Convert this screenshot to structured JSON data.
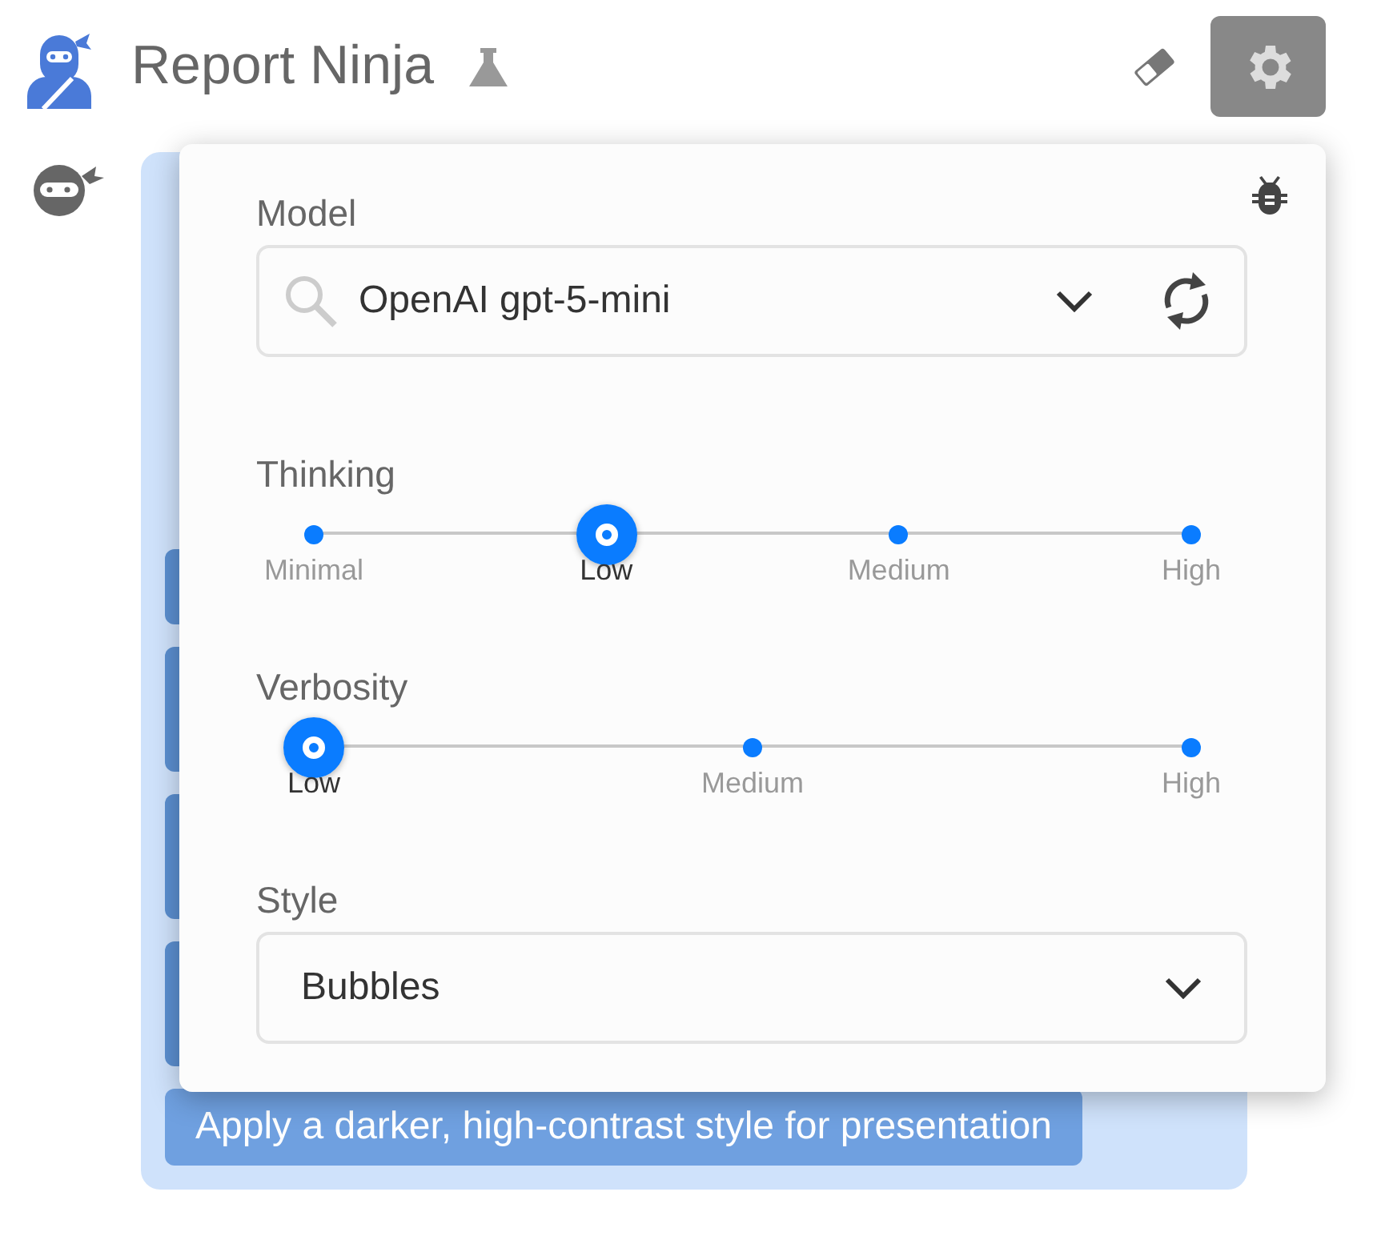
{
  "header": {
    "title": "Report Ninja"
  },
  "chat": {
    "message": {
      "suggestions": [
        {
          "kind": "hidden"
        },
        {
          "kind": "hidden"
        },
        {
          "kind": "hidden"
        },
        {
          "kind": "hidden"
        },
        {
          "kind": "text",
          "label": "Apply a darker, high-contrast style for presentation"
        }
      ]
    }
  },
  "settings_panel": {
    "model": {
      "label": "Model",
      "value": "OpenAI gpt-5-mini"
    },
    "sliders": [
      {
        "label": "Thinking",
        "options": [
          {
            "label": "Minimal",
            "selected": false
          },
          {
            "label": "Low",
            "selected": true
          },
          {
            "label": "Medium",
            "selected": false
          },
          {
            "label": "High",
            "selected": false
          }
        ]
      },
      {
        "label": "Verbosity",
        "options": [
          {
            "label": "Low",
            "selected": true
          },
          {
            "label": "Medium",
            "selected": false
          },
          {
            "label": "High",
            "selected": false
          }
        ]
      }
    ],
    "style": {
      "label": "Style",
      "value": "Bubbles"
    }
  }
}
